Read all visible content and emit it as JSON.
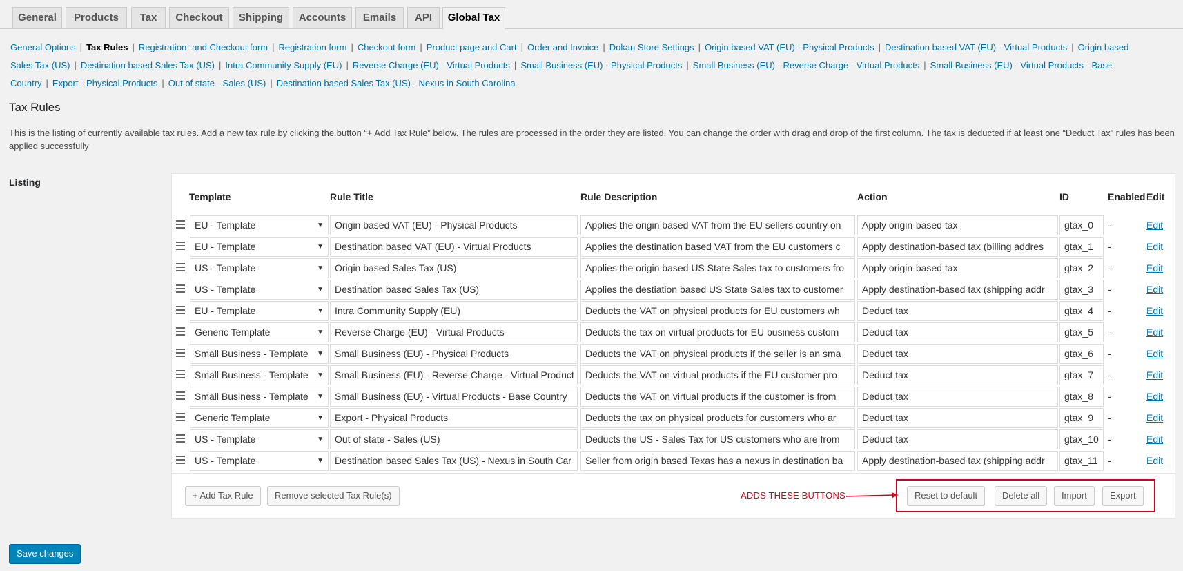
{
  "tabs": [
    "General",
    "Products",
    "Tax",
    "Checkout",
    "Shipping",
    "Accounts",
    "Emails",
    "API",
    "Global Tax"
  ],
  "active_tab": "Global Tax",
  "subnav": [
    "General Options",
    "Tax Rules",
    "Registration- and Checkout form",
    "Registration form",
    "Checkout form",
    "Product page and Cart",
    "Order and Invoice",
    "Dokan Store Settings",
    "Origin based VAT (EU) - Physical Products",
    "Destination based VAT (EU) - Virtual Products",
    "Origin based Sales Tax (US)",
    "Destination based Sales Tax (US)",
    "Intra Community Supply (EU)",
    "Reverse Charge (EU) - Virtual Products",
    "Small Business (EU) - Physical Products",
    "Small Business (EU) - Reverse Charge - Virtual Products",
    "Small Business (EU) - Virtual Products - Base Country",
    "Export - Physical Products",
    "Out of state - Sales (US)",
    "Destination based Sales Tax (US) - Nexus in South Carolina"
  ],
  "page_title": "Tax Rules",
  "description": "This is the listing of currently available tax rules. Add a new tax rule by clicking the button “+ Add Tax Rule” below. The rules are processed in the order they are listed. You can change the order with drag and drop of the first column. The tax is deducted if at least one “Deduct Tax” rules has been applied successfully",
  "listing_label": "Listing",
  "table": {
    "headers": {
      "template": "Template",
      "title": "Rule Title",
      "desc": "Rule Description",
      "action": "Action",
      "id": "ID",
      "enabled": "Enabled",
      "edit": "Edit"
    },
    "rows": [
      {
        "template": "EU - Template",
        "title": "Origin based VAT (EU) - Physical Products",
        "desc": "Applies the origin based VAT from the EU sellers country on",
        "action": "Apply origin-based tax",
        "id": "gtax_0",
        "enabled": "-",
        "edit": "Edit"
      },
      {
        "template": "EU - Template",
        "title": "Destination based VAT (EU) - Virtual Products",
        "desc": "Applies the destination based VAT from the EU customers c",
        "action": "Apply destination-based tax (billing addres",
        "id": "gtax_1",
        "enabled": "-",
        "edit": "Edit"
      },
      {
        "template": "US - Template",
        "title": "Origin based Sales Tax (US)",
        "desc": "Applies the origin based US State Sales tax to customers fro",
        "action": "Apply origin-based tax",
        "id": "gtax_2",
        "enabled": "-",
        "edit": "Edit"
      },
      {
        "template": "US - Template",
        "title": "Destination based Sales Tax (US)",
        "desc": "Applies the destiation based US State Sales tax to customer",
        "action": "Apply destination-based tax (shipping addr",
        "id": "gtax_3",
        "enabled": "-",
        "edit": "Edit"
      },
      {
        "template": "EU - Template",
        "title": "Intra Community Supply (EU)",
        "desc": "Deducts the VAT on physical products for EU customers wh",
        "action": "Deduct tax",
        "id": "gtax_4",
        "enabled": "-",
        "edit": "Edit"
      },
      {
        "template": "Generic Template",
        "title": "Reverse Charge (EU) - Virtual Products",
        "desc": "Deducts the tax on virtual products for EU business custom",
        "action": "Deduct tax",
        "id": "gtax_5",
        "enabled": "-",
        "edit": "Edit"
      },
      {
        "template": "Small Business - Template",
        "title": "Small Business (EU) - Physical Products",
        "desc": "Deducts the VAT on physical products if the seller is an sma",
        "action": "Deduct tax",
        "id": "gtax_6",
        "enabled": "-",
        "edit": "Edit"
      },
      {
        "template": "Small Business - Template",
        "title": "Small Business (EU) - Reverse Charge - Virtual Product",
        "desc": "Deducts the VAT on virtual products if the EU customer pro",
        "action": "Deduct tax",
        "id": "gtax_7",
        "enabled": "-",
        "edit": "Edit"
      },
      {
        "template": "Small Business - Template",
        "title": "Small Business (EU) - Virtual Products - Base Country",
        "desc": "Deducts the VAT on virtual products if the customer is from",
        "action": "Deduct tax",
        "id": "gtax_8",
        "enabled": "-",
        "edit": "Edit"
      },
      {
        "template": "Generic Template",
        "title": "Export - Physical Products",
        "desc": "Deducts the tax on physical products for customers who ar",
        "action": "Deduct tax",
        "id": "gtax_9",
        "enabled": "-",
        "edit": "Edit"
      },
      {
        "template": "US - Template",
        "title": "Out of state - Sales (US)",
        "desc": "Deducts the US - Sales Tax for US customers who are from",
        "action": "Deduct tax",
        "id": "gtax_10",
        "enabled": "-",
        "edit": "Edit"
      },
      {
        "template": "US - Template",
        "title": "Destination based Sales Tax (US) - Nexus in South Car",
        "desc": "Seller from origin based Texas has a nexus in destination ba",
        "action": "Apply destination-based tax (shipping addr",
        "id": "gtax_11",
        "enabled": "-",
        "edit": "Edit"
      }
    ]
  },
  "buttons": {
    "add": "+ Add Tax Rule",
    "remove": "Remove selected Tax Rule(s)",
    "reset": "Reset to default",
    "delete_all": "Delete all",
    "import": "Import",
    "export": "Export",
    "save": "Save changes"
  },
  "annotation": "ADDS THESE BUTTONS",
  "colors": {
    "link": "#0073aa",
    "annotation": "#d0021b",
    "primary": "#0085ba"
  },
  "icons": {
    "drag": "drag-handle-icon",
    "dropdown": "chevron-down-icon"
  }
}
